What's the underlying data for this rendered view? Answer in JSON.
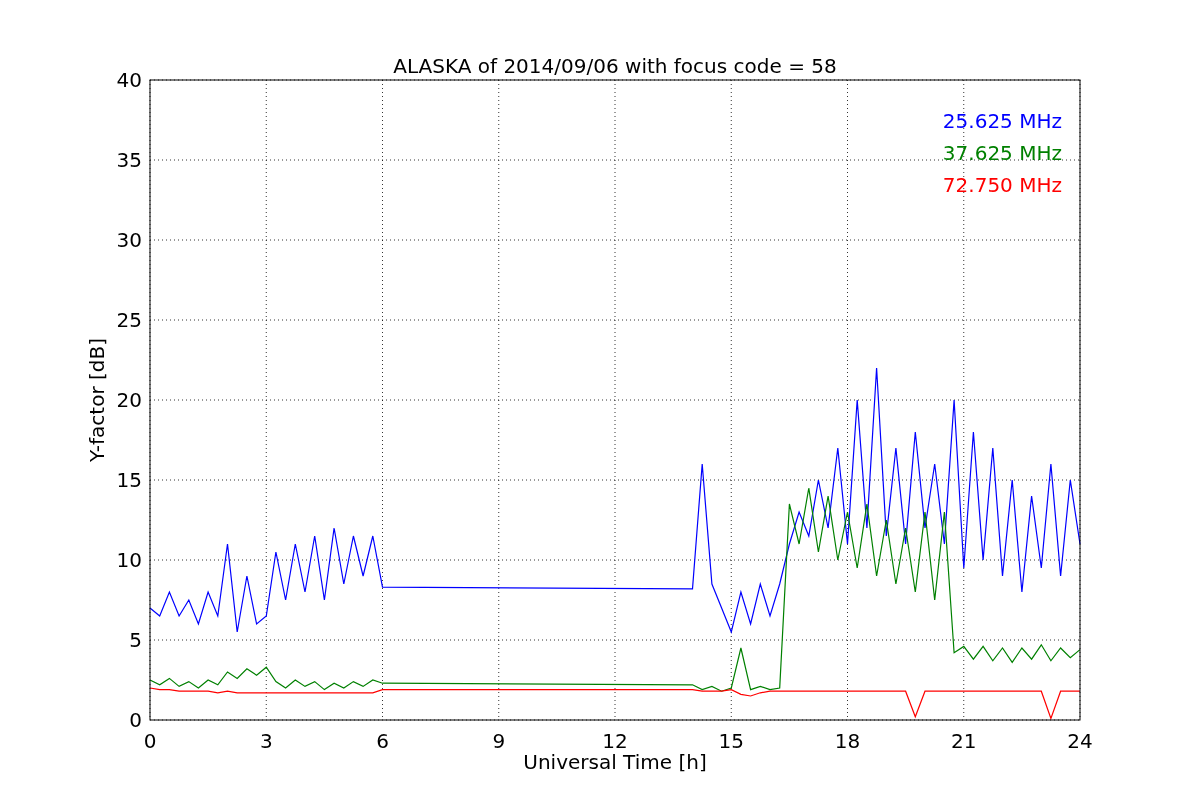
{
  "figure": {
    "chart_data": {
      "type": "line",
      "title": "ALASKA of 2014/09/06 with focus code = 58",
      "xlabel": "Universal Time [h]",
      "ylabel": "Y-factor [dB]",
      "x": [
        0,
        0.25,
        0.5,
        0.75,
        1,
        1.25,
        1.5,
        1.75,
        2,
        2.25,
        2.5,
        2.75,
        3,
        3.25,
        3.5,
        3.75,
        4,
        4.25,
        4.5,
        4.75,
        5,
        5.25,
        5.5,
        5.75,
        6,
        14,
        14.25,
        14.5,
        14.75,
        15,
        15.25,
        15.5,
        15.75,
        16,
        16.25,
        16.5,
        16.75,
        17,
        17.25,
        17.5,
        17.75,
        18,
        18.25,
        18.5,
        18.75,
        19,
        19.25,
        19.5,
        19.75,
        20,
        20.25,
        20.5,
        20.75,
        21,
        21.25,
        21.5,
        21.75,
        22,
        22.25,
        22.5,
        22.75,
        23,
        23.25,
        23.5,
        23.75,
        24
      ],
      "series": [
        {
          "name": "25.625 MHz",
          "color": "#0000ff",
          "values": [
            7,
            6.5,
            8,
            6.5,
            7.5,
            6,
            8,
            6.5,
            11,
            5.5,
            9,
            6,
            6.5,
            10.5,
            7.5,
            11,
            8,
            11.5,
            7.5,
            12,
            8.5,
            11.5,
            9,
            11.5,
            8.3,
            8.2,
            16,
            8.5,
            7,
            5.5,
            8,
            6,
            8.5,
            6.5,
            8.5,
            11,
            13,
            11.5,
            15,
            12,
            17,
            11,
            20,
            12,
            22,
            11.5,
            17,
            11,
            18,
            12,
            16,
            11,
            20,
            9.5,
            18,
            10,
            17,
            9,
            15,
            8,
            14,
            9.5,
            16,
            9,
            15,
            11
          ]
        },
        {
          "name": "37.625 MHz",
          "color": "#008000",
          "values": [
            2.5,
            2.2,
            2.6,
            2.1,
            2.4,
            2,
            2.5,
            2.2,
            3,
            2.6,
            3.2,
            2.8,
            3.3,
            2.4,
            2,
            2.5,
            2.1,
            2.4,
            1.9,
            2.3,
            2,
            2.4,
            2.1,
            2.5,
            2.3,
            2.2,
            1.9,
            2.1,
            1.8,
            2,
            4.5,
            1.9,
            2.1,
            1.9,
            2,
            13.5,
            11,
            14.5,
            10.5,
            14,
            10,
            13,
            9.5,
            13.5,
            9,
            12.5,
            8.5,
            12,
            8,
            13,
            7.5,
            13,
            4.2,
            4.6,
            3.8,
            4.6,
            3.7,
            4.5,
            3.6,
            4.5,
            3.8,
            4.7,
            3.7,
            4.5,
            3.9,
            4.4
          ]
        },
        {
          "name": "72.750 MHz",
          "color": "#ff0000",
          "values": [
            2,
            1.9,
            1.9,
            1.8,
            1.8,
            1.8,
            1.8,
            1.7,
            1.8,
            1.7,
            1.7,
            1.7,
            1.7,
            1.7,
            1.7,
            1.7,
            1.7,
            1.7,
            1.7,
            1.7,
            1.7,
            1.7,
            1.7,
            1.7,
            1.9,
            1.9,
            1.8,
            1.8,
            1.8,
            1.9,
            1.6,
            1.5,
            1.7,
            1.8,
            1.8,
            1.8,
            1.8,
            1.8,
            1.8,
            1.8,
            1.8,
            1.8,
            1.8,
            1.8,
            1.8,
            1.8,
            1.8,
            1.8,
            0.2,
            1.8,
            1.8,
            1.8,
            1.8,
            1.8,
            1.8,
            1.8,
            1.8,
            1.8,
            1.8,
            1.8,
            1.8,
            1.8,
            0.1,
            1.8,
            1.8,
            1.8
          ]
        }
      ],
      "grid": true,
      "xlim": [
        0,
        24
      ],
      "ylim": [
        0,
        40
      ],
      "xticks": [
        0,
        3,
        6,
        9,
        12,
        15,
        18,
        21,
        24
      ],
      "yticks": [
        0,
        5,
        10,
        15,
        20,
        25,
        30,
        35,
        40
      ]
    }
  }
}
